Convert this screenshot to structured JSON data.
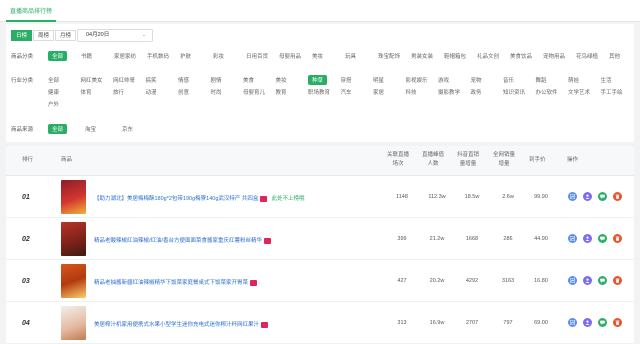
{
  "header": {
    "tab": "直播商品排行榜"
  },
  "period": {
    "options": [
      "日榜",
      "周榜",
      "月榜"
    ],
    "selected": "日榜",
    "date": "04月20日"
  },
  "category": {
    "label": "商品分类",
    "items": [
      "全部",
      "书籍",
      "家居家纺",
      "手机数码",
      "护肤",
      "彩妆",
      "日用百货",
      "母婴用品",
      "美妆",
      "玩具",
      "珠宝配饰",
      "男装女装",
      "鞋帽箱包",
      "礼品文创",
      "美食饮品",
      "宠物用品",
      "花鸟绿植",
      "其他"
    ]
  },
  "industry": {
    "label": "行业分类",
    "row1": [
      "全部",
      "网红美女",
      "网红帅哥",
      "搞笑",
      "情感",
      "剧情",
      "美食",
      "美妆",
      "种草",
      "穿搭",
      "明星",
      "影视娱乐",
      "游戏",
      "宠物",
      "音乐",
      "舞蹈",
      "萌娃",
      "生活"
    ],
    "row2": [
      "健康",
      "体育",
      "旅行",
      "动漫",
      "创意",
      "时尚",
      "母婴育儿",
      "教育",
      "职场教育",
      "汽车",
      "家居",
      "科技",
      "摄影教学",
      "政务",
      "知识资讯",
      "办公软件",
      "文学艺术",
      "手工手绘"
    ],
    "row3": [
      "户外"
    ],
    "active": "种草"
  },
  "source": {
    "label": "商品来源",
    "items": [
      "全部",
      "淘宝",
      "京东"
    ],
    "active": "全部"
  },
  "table": {
    "headers": {
      "rank": "排行",
      "product": "商品",
      "views": "关联直播\n场次",
      "live_viewers": "直播峰值\n人数",
      "estimated_sales": "抖音直销\n量增量",
      "net_sales": "全网销量\n增量",
      "price": "到手价",
      "ops": "操作"
    },
    "rows": [
      {
        "rank": "01",
        "name": "【助力湖北】美居梅梅酥180g*2包带190g梅寮140g武汉特产 共四盒",
        "extra": "此处不上榜哦",
        "views": "1148",
        "viewers": "112.3w",
        "est": "18.5w",
        "net": "2.6w",
        "price": "99.90"
      },
      {
        "rank": "02",
        "name": "精品老酸辣椒红油辣椒/红油/香台方便面面菜食酱家重庆红薯粉丝精华",
        "extra": "",
        "views": "399",
        "viewers": "21.2w",
        "est": "1668",
        "net": "286",
        "price": "44.90"
      },
      {
        "rank": "03",
        "name": "精品老抽酱新疆红油辣椒精华下饭菜家庭餐桌式下饭菜家开胃菜",
        "extra": "",
        "views": "427",
        "viewers": "20.2w",
        "est": "4292",
        "net": "3163",
        "price": "16.80"
      },
      {
        "rank": "04",
        "name": "美居榨汁机家用便携式水果小型学生迷你充电式迷你榨汁杯网红果汁",
        "extra": "",
        "views": "313",
        "viewers": "16.9w",
        "est": "2707",
        "net": "797",
        "price": "69.00"
      }
    ]
  },
  "colors": {
    "accent": "#2aae67",
    "link": "#2b6fd1",
    "badge": "#e0245e"
  }
}
